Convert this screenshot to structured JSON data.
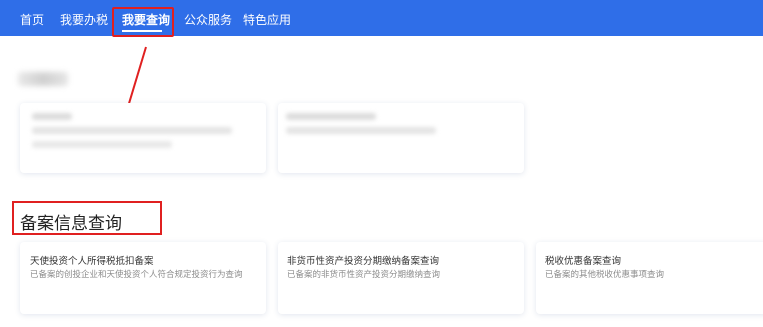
{
  "nav": {
    "items": [
      {
        "label": "首页"
      },
      {
        "label": "我要办税"
      },
      {
        "label": "我要查询"
      },
      {
        "label": "公众服务"
      },
      {
        "label": "特色应用"
      }
    ]
  },
  "section": {
    "title": "备案信息查询"
  },
  "query_cards": [
    {
      "title": "天使投资个人所得税抵扣备案",
      "desc": "已备案的创投企业和天使投资个人符合规定投资行为查询"
    },
    {
      "title": "非货币性资产投资分期缴纳备案查询",
      "desc": "已备案的非货币性资产投资分期缴纳查询"
    },
    {
      "title": "税收优惠备案查询",
      "desc": "已备案的其他税收优惠事项查询"
    }
  ],
  "colors": {
    "nav_bg": "#2f6ee8",
    "highlight": "#e02020"
  }
}
